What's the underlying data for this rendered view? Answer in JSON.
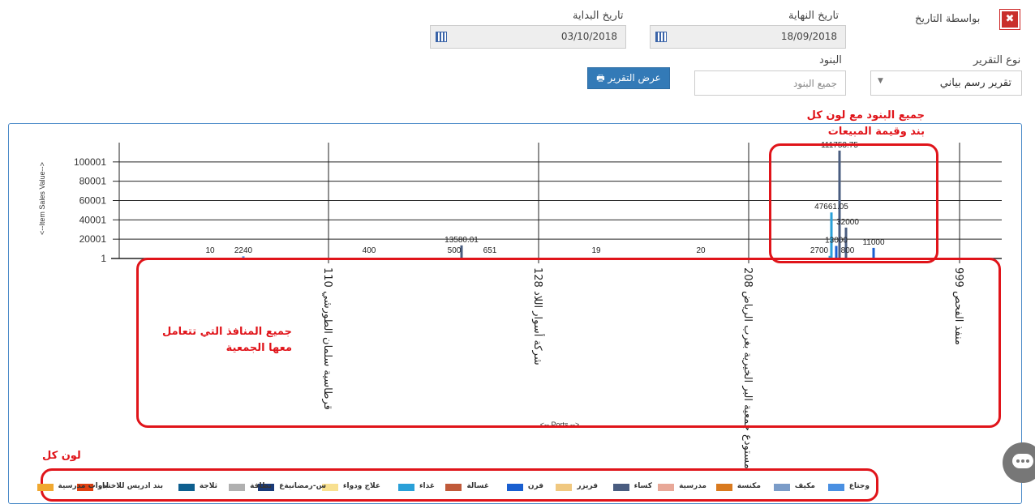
{
  "filters": {
    "by_date_label": "بواسطة التاريخ",
    "end_date_label": "تاريخ النهاية",
    "end_date_value": "18/09/2018",
    "start_date_label": "تاريخ البداية",
    "start_date_value": "03/10/2018",
    "report_type_label": "نوع التقرير",
    "report_type_value": "تقرير رسم بياني",
    "items_label": "البنود",
    "items_placeholder": "جميع البنود",
    "show_report_button": "عرض التقرير",
    "close_symbol": "✖"
  },
  "annotations": {
    "items_note_line1": "جميع البنود مع لون كل",
    "items_note_line2": "بند وقيمة المبيعات",
    "ports_note_line1": "جميع المنافذ التي تتعامل",
    "ports_note_line2": "معها الجمعية",
    "color_note": "لون كل"
  },
  "chart_data": {
    "type": "bar",
    "ylabel": "<--Item Sales Value-->",
    "xlabel": "<-- Ports -->",
    "y_ticks": [
      "1",
      "20001",
      "40001",
      "60001",
      "80001",
      "100001"
    ],
    "ylim": [
      1,
      120000
    ],
    "grid": true,
    "categories": [
      "110 قرطاسية سلمان الطورشي",
      "128 شركة أسوار اللاد",
      "208 مستودع جمعية البر الخيرية بغرب الرياض",
      "999 منفذ الفحص"
    ],
    "value_labels": [
      {
        "text": "10",
        "value": 10
      },
      {
        "text": "2240",
        "value": 2240
      },
      {
        "text": "400",
        "value": 400
      },
      {
        "text": "500",
        "value": 500
      },
      {
        "text": "13580.01",
        "value": 13580.01
      },
      {
        "text": "651",
        "value": 651
      },
      {
        "text": "19",
        "value": 19
      },
      {
        "text": "20",
        "value": 20
      },
      {
        "text": "111753.75",
        "value": 111753.75
      },
      {
        "text": "47661.05",
        "value": 47661.05
      },
      {
        "text": "32000",
        "value": 32000
      },
      {
        "text": "13000",
        "value": 13000
      },
      {
        "text": "11000",
        "value": 11000
      },
      {
        "text": "2700",
        "value": 2700
      },
      {
        "text": "800",
        "value": 800
      }
    ],
    "legend": [
      {
        "name": "وجتاع",
        "color": "#4a90e2"
      },
      {
        "name": "مكيف",
        "color": "#7b9cc8"
      },
      {
        "name": "مكنسة",
        "color": "#d97a1f"
      },
      {
        "name": "مدرسية",
        "color": "#e8a898"
      },
      {
        "name": "كساء",
        "color": "#4a5d80"
      },
      {
        "name": "فريزر",
        "color": "#f0c880"
      },
      {
        "name": "فرن",
        "color": "#1a5fd0"
      },
      {
        "name": "غسالة",
        "color": "#c05a3a"
      },
      {
        "name": "غذاء",
        "color": "#2aa0d8"
      },
      {
        "name": "علاج ودواء",
        "color": "#f8e090"
      },
      {
        "name": "س-رمضانيةع",
        "color": "#1a3a78"
      },
      {
        "name": "نظافة",
        "color": "#b0b0b0"
      },
      {
        "name": "ثلاجة",
        "color": "#0e5f8f"
      },
      {
        "name": "بند ادريس للاختبار",
        "color": "#e04010"
      },
      {
        "name": "ادوات مدرسية",
        "color": "#f0a830"
      }
    ]
  }
}
